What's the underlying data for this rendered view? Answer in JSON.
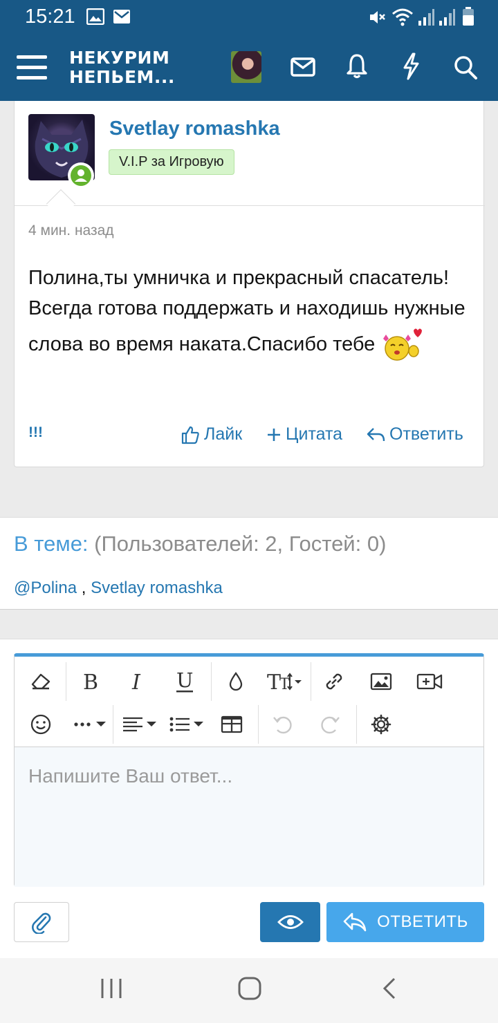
{
  "status_bar": {
    "time": "15:21"
  },
  "header": {
    "logo_line1": "НЕКУРИМ",
    "logo_line2": "НЕПЬЕМ..."
  },
  "post": {
    "username": "Svetlay romashka",
    "user_title": "V.I.P за Игровую",
    "time": "4 мин. назад",
    "body_text": "Полина,ты умничка и прекрасный спасатель!Всегда готова поддержать и находишь нужные слова во время наката.Спасибо тебе",
    "actions": {
      "report": "!!!",
      "like": "Лайк",
      "quote": "Цитата",
      "reply": "Ответить"
    }
  },
  "viewers": {
    "label": "В теме:",
    "counts": "(Пользователей: 2, Гостей: 0)",
    "user1": "@Polina",
    "separator": ",",
    "user2": "Svetlay romashka"
  },
  "editor": {
    "placeholder": "Напишите Ваш ответ...",
    "reply_button": "ОТВЕТИТЬ"
  },
  "colors": {
    "header_bg": "#185886",
    "link": "#2577b1",
    "accent": "#47a7eb",
    "badge_bg": "#d6f5cb",
    "online": "#63b32e"
  }
}
